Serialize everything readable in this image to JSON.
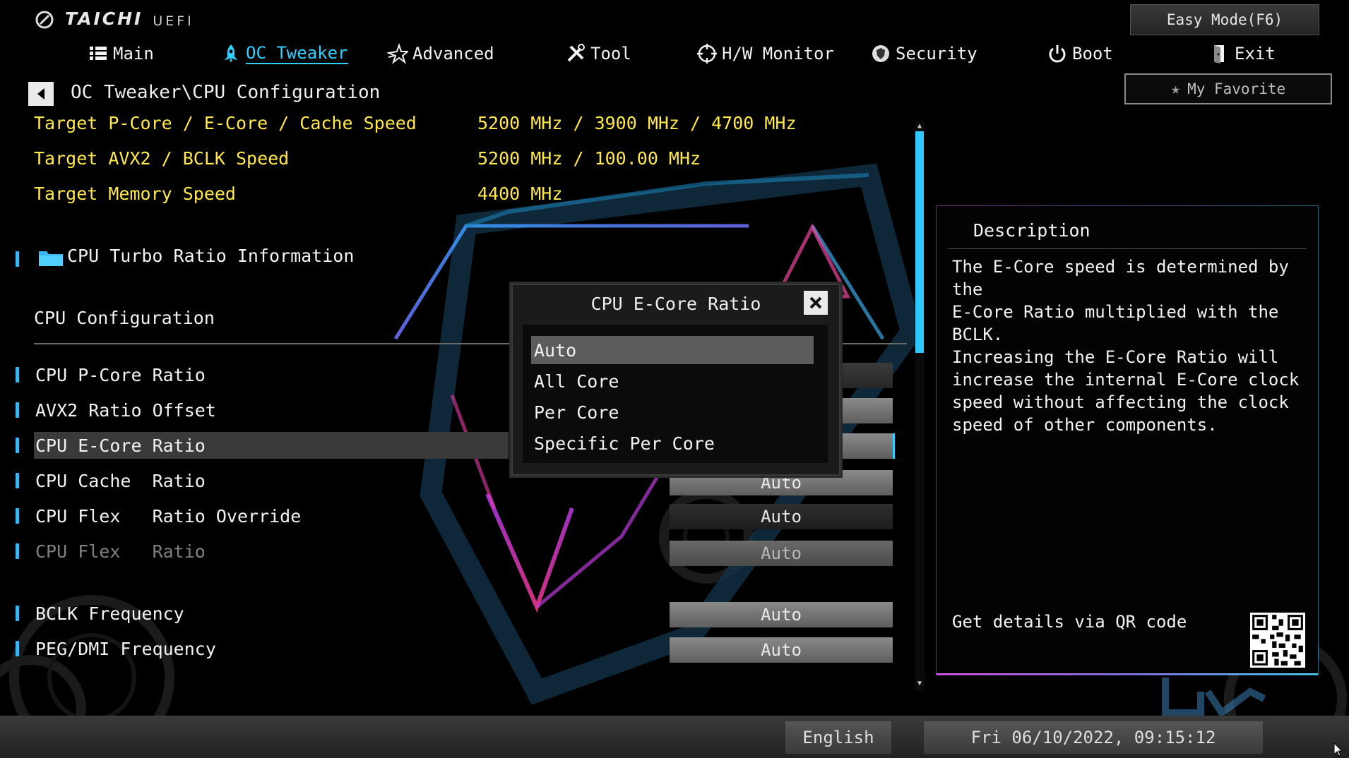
{
  "brand": {
    "name": "TAICHI",
    "sub": "UEFI"
  },
  "easy_mode": "Easy Mode(F6)",
  "my_favorite": "My Favorite",
  "tabs": [
    {
      "label": "Main",
      "icon": "list-icon"
    },
    {
      "label": "OC Tweaker",
      "icon": "rocket-icon",
      "active": true
    },
    {
      "label": "Advanced",
      "icon": "star-icon"
    },
    {
      "label": "Tool",
      "icon": "tools-icon"
    },
    {
      "label": "H/W Monitor",
      "icon": "crosshair-icon"
    },
    {
      "label": "Security",
      "icon": "shield-icon"
    },
    {
      "label": "Boot",
      "icon": "power-icon"
    },
    {
      "label": "Exit",
      "icon": "exit-door-icon"
    }
  ],
  "breadcrumb": "OC Tweaker\\CPU Configuration",
  "targets": [
    {
      "label": "Target P-Core / E-Core / Cache Speed",
      "value": "5200 MHz / 3900 MHz / 4700 MHz"
    },
    {
      "label": "Target AVX2 / BCLK Speed",
      "value": "5200 MHz / 100.00 MHz"
    },
    {
      "label": "Target Memory Speed",
      "value": "4400 MHz"
    }
  ],
  "turbo_info": "CPU Turbo Ratio Information",
  "section": "CPU Configuration",
  "items": [
    {
      "label": "CPU P-Core Ratio",
      "value": ""
    },
    {
      "label": "AVX2 Ratio Offset",
      "value": ""
    },
    {
      "label": "CPU E-Core Ratio",
      "value": ""
    },
    {
      "label": "CPU Cache  Ratio",
      "value": "Auto"
    },
    {
      "label": "CPU Flex   Ratio Override",
      "value": "Auto"
    },
    {
      "label": "CPU Flex   Ratio",
      "value": "Auto"
    },
    {
      "label": "BCLK Frequency",
      "value": "Auto"
    },
    {
      "label": "PEG/DMI Frequency",
      "value": "Auto"
    }
  ],
  "popup": {
    "title": "CPU E-Core Ratio",
    "options": [
      "Auto",
      "All Core",
      "Per Core",
      "Specific Per Core"
    ],
    "selected": "Auto"
  },
  "description": {
    "title": "Description",
    "text": "The E-Core speed is determined by the\nE-Core Ratio multiplied with the BCLK.\nIncreasing the E-Core Ratio will\nincrease the internal E-Core clock\nspeed without affecting the clock\nspeed of other components.",
    "qr_label": "Get details via QR code"
  },
  "footer": {
    "language": "English",
    "datetime": "Fri 06/10/2022, 09:15:12"
  },
  "colors": {
    "accent": "#2fd2ff",
    "target_text": "#ffe94a",
    "panel_border_start": "#e85cff",
    "panel_border_end": "#4fd8ff"
  }
}
